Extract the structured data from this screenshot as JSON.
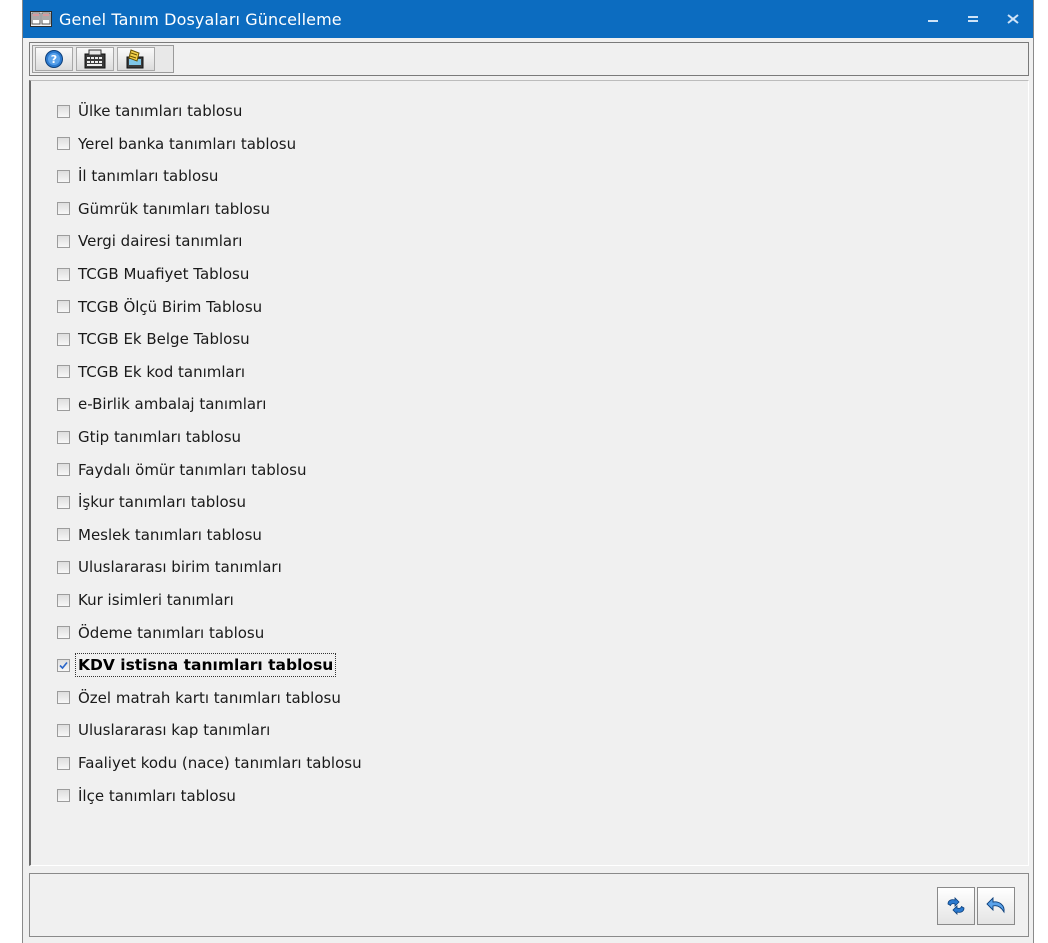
{
  "window": {
    "title": "Genel Tanım Dosyaları Güncelleme",
    "minimize": "–",
    "maximize": "=",
    "close": "✕"
  },
  "toolbar": {
    "buttons": [
      {
        "icon": "help-icon"
      },
      {
        "icon": "calculator-icon"
      },
      {
        "icon": "update-icon"
      }
    ]
  },
  "checklist": {
    "items": [
      {
        "label": "Ülke tanımları tablosu",
        "checked": false
      },
      {
        "label": "Yerel banka tanımları tablosu",
        "checked": false
      },
      {
        "label": "İl tanımları tablosu",
        "checked": false
      },
      {
        "label": "Gümrük tanımları tablosu",
        "checked": false
      },
      {
        "label": "Vergi dairesi tanımları",
        "checked": false
      },
      {
        "label": "TCGB Muafiyet Tablosu",
        "checked": false
      },
      {
        "label": "TCGB Ölçü Birim Tablosu",
        "checked": false
      },
      {
        "label": "TCGB Ek Belge Tablosu",
        "checked": false
      },
      {
        "label": "TCGB Ek kod tanımları",
        "checked": false
      },
      {
        "label": "e-Birlik ambalaj tanımları",
        "checked": false
      },
      {
        "label": "Gtip tanımları tablosu",
        "checked": false
      },
      {
        "label": "Faydalı ömür tanımları tablosu",
        "checked": false
      },
      {
        "label": "İşkur tanımları tablosu",
        "checked": false
      },
      {
        "label": "Meslek tanımları tablosu",
        "checked": false
      },
      {
        "label": "Uluslararası birim tanımları",
        "checked": false
      },
      {
        "label": "Kur isimleri tanımları",
        "checked": false
      },
      {
        "label": "Ödeme tanımları tablosu",
        "checked": false
      },
      {
        "label": "KDV istisna tanımları tablosu",
        "checked": true
      },
      {
        "label": "Özel matrah kartı tanımları tablosu",
        "checked": false
      },
      {
        "label": "Uluslararası kap tanımları",
        "checked": false
      },
      {
        "label": "Faaliyet kodu (nace) tanımları tablosu",
        "checked": false
      },
      {
        "label": "İlçe tanımları tablosu",
        "checked": false
      }
    ]
  },
  "actions": {
    "buttons": [
      {
        "icon": "refresh-icon"
      },
      {
        "icon": "undo-icon"
      }
    ]
  },
  "colors": {
    "titlebar": "#0c6cc0",
    "window_bg": "#f0f0f0",
    "icon_blue": "#2b7ad0"
  }
}
